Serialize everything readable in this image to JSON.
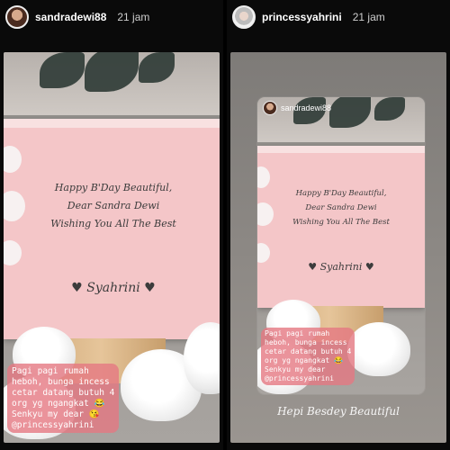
{
  "left_story": {
    "username": "sandradewi88",
    "time": "21 jam",
    "card": {
      "line1": "Happy B'Day Beautiful,",
      "line2": "Dear Sandra Dewi",
      "line3": "Wishing You All The Best",
      "signature": "♥ Syahrini ♥"
    },
    "caption": [
      "Pagi pagi rumah",
      "heboh, bunga incess",
      "cetar datang butuh 4",
      "org yg ngangkat 😂",
      "Senkyu my dear 😘",
      "@princessyahrini"
    ]
  },
  "right_story": {
    "username": "princessyahrini",
    "time": "21 jam",
    "repost": {
      "username": "sandradewi88",
      "card": {
        "line1": "Happy B'Day Beautiful,",
        "line2": "Dear Sandra Dewi",
        "line3": "Wishing You All The Best",
        "signature": "♥ Syahrini ♥"
      },
      "caption": [
        "Pagi pagi rumah",
        "heboh, bunga incess",
        "cetar datang butuh 4",
        "org yg ngangkat 😂",
        "Senkyu my dear",
        "@princessyahrini"
      ]
    },
    "overlay_text": "Hepi Besdey Beautiful"
  }
}
